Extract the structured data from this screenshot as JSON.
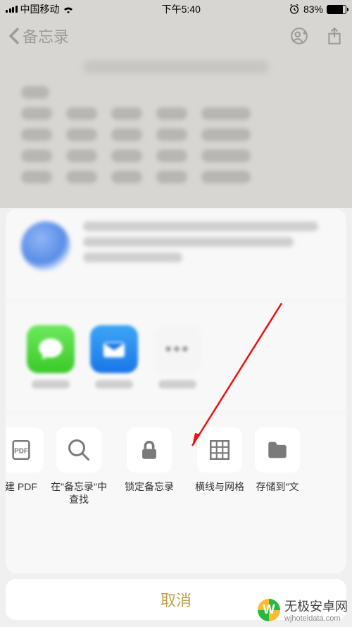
{
  "statusBar": {
    "carrier": "中国移动",
    "time": "下午5:40",
    "batteryPct": "83%"
  },
  "nav": {
    "backLabel": "备忘录"
  },
  "actions": [
    {
      "key": "pdf",
      "label": "建 PDF"
    },
    {
      "key": "search",
      "label": "在\"备忘录\"中\n查找"
    },
    {
      "key": "lock",
      "label": "锁定备忘录"
    },
    {
      "key": "grid",
      "label": "横线与网格"
    },
    {
      "key": "files",
      "label": "存储到\"文"
    }
  ],
  "cancel": "取消",
  "watermark": {
    "title": "无极安卓网",
    "url": "wjhoteldata.com"
  }
}
